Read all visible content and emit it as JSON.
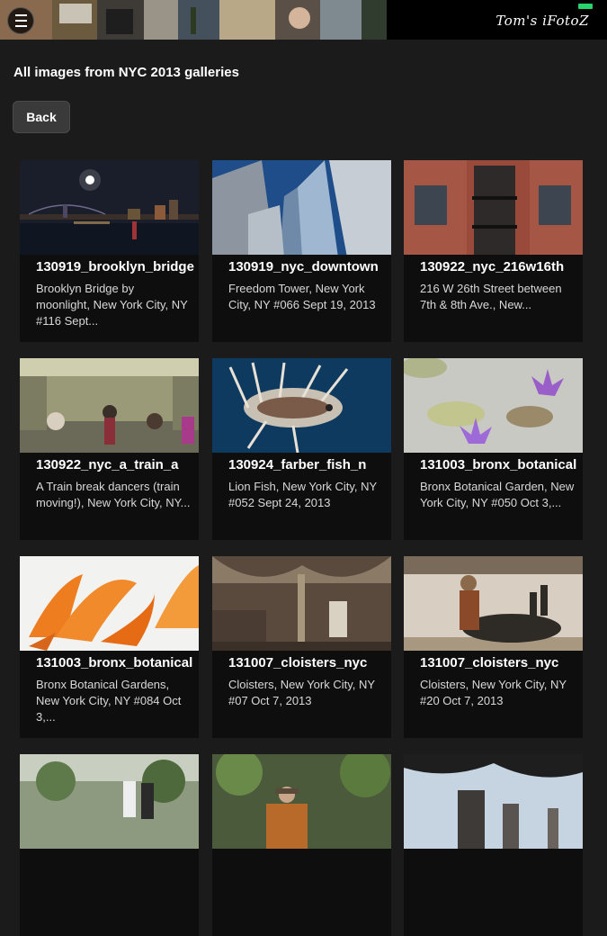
{
  "header": {
    "brand": "Tom's iFotoZ",
    "menu_icon": "hamburger-menu-icon"
  },
  "page": {
    "title": "All images from NYC 2013 galleries",
    "back_label": "Back"
  },
  "gallery": [
    {
      "title": "130919_brooklyn_bridge",
      "desc": "Brooklyn Bridge by moonlight, New York City, NY #116 Sept..."
    },
    {
      "title": "130919_nyc_downtown",
      "desc": "Freedom Tower, New York City, NY #066 Sept 19, 2013"
    },
    {
      "title": "130922_nyc_216w16th",
      "desc": "216 W 26th Street between 7th & 8th Ave., New..."
    },
    {
      "title": "130922_nyc_a_train_a",
      "desc": "A Train break dancers (train moving!), New York City, NY..."
    },
    {
      "title": "130924_farber_fish_n",
      "desc": "Lion Fish, New York City, NY #052 Sept 24, 2013"
    },
    {
      "title": "131003_bronx_botanical",
      "desc": "Bronx Botanical Garden, New York City, NY #050 Oct 3,..."
    },
    {
      "title": "131003_bronx_botanical",
      "desc": "Bronx Botanical Gardens, New York City, NY #084 Oct 3,..."
    },
    {
      "title": "131007_cloisters_nyc",
      "desc": "Cloisters, New York City, NY #07 Oct 7, 2013"
    },
    {
      "title": "131007_cloisters_nyc",
      "desc": "Cloisters, New York City, NY #20 Oct 7, 2013"
    },
    {
      "title": "",
      "desc": ""
    },
    {
      "title": "",
      "desc": ""
    },
    {
      "title": "",
      "desc": ""
    }
  ]
}
